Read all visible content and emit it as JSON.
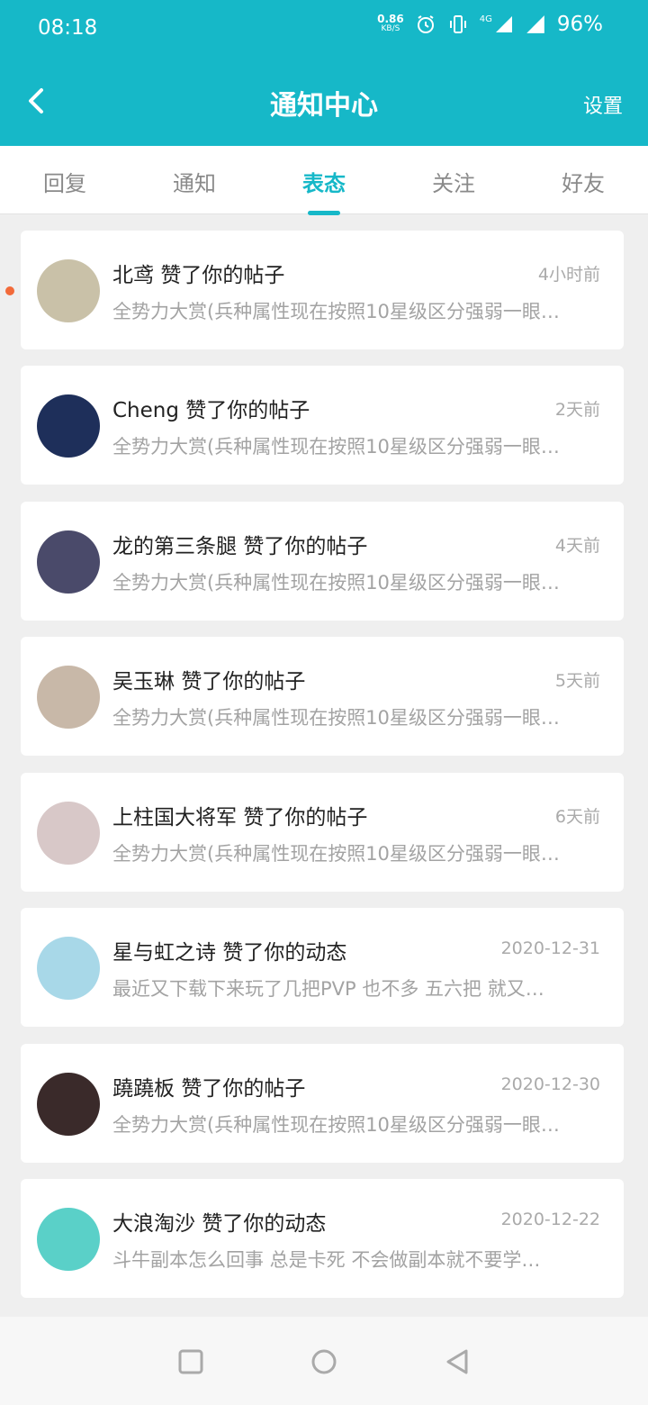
{
  "status_bar": {
    "time": "08:18",
    "net_speed_value": "0.86",
    "net_speed_unit": "KB/S",
    "network_type": "4G",
    "battery": "96%",
    "icons": [
      "alarm-icon",
      "vibrate-icon",
      "signal-icon",
      "battery-icon"
    ]
  },
  "header": {
    "title": "通知中心",
    "settings_label": "设置",
    "back_icon": "chevron-left-icon"
  },
  "tabs": [
    {
      "label": "回复",
      "active": false
    },
    {
      "label": "通知",
      "active": false
    },
    {
      "label": "表态",
      "active": true
    },
    {
      "label": "关注",
      "active": false
    },
    {
      "label": "好友",
      "active": false
    }
  ],
  "notifications": [
    {
      "user": "北鸢",
      "action": "赞了你的帖子",
      "time": "4小时前",
      "excerpt": "全势力大赏(兵种属性现在按照10星级区分强弱一眼…",
      "unread": true,
      "avatar_color": "#c9c1a8"
    },
    {
      "user": "Cheng",
      "action": "赞了你的帖子",
      "time": "2天前",
      "excerpt": "全势力大赏(兵种属性现在按照10星级区分强弱一眼…",
      "unread": false,
      "avatar_color": "#1e2f5a"
    },
    {
      "user": "龙的第三条腿",
      "action": "赞了你的帖子",
      "time": "4天前",
      "excerpt": "全势力大赏(兵种属性现在按照10星级区分强弱一眼…",
      "unread": false,
      "avatar_color": "#4a4a6a"
    },
    {
      "user": "吴玉琳",
      "action": "赞了你的帖子",
      "time": "5天前",
      "excerpt": "全势力大赏(兵种属性现在按照10星级区分强弱一眼…",
      "unread": false,
      "avatar_color": "#c8b8a8"
    },
    {
      "user": "上柱国大将军",
      "action": "赞了你的帖子",
      "time": "6天前",
      "excerpt": "全势力大赏(兵种属性现在按照10星级区分强弱一眼…",
      "unread": false,
      "avatar_color": "#d8c8c8"
    },
    {
      "user": "星与虹之诗",
      "action": "赞了你的动态",
      "time": "2020-12-31",
      "excerpt": "最近又下载下来玩了几把PVP 也不多 五六把 就又…",
      "unread": false,
      "avatar_color": "#a8d8e8"
    },
    {
      "user": "蹺蹺板",
      "action": "赞了你的帖子",
      "time": "2020-12-30",
      "excerpt": "全势力大赏(兵种属性现在按照10星级区分强弱一眼…",
      "unread": false,
      "avatar_color": "#3a2a2a"
    },
    {
      "user": "大浪淘沙",
      "action": "赞了你的动态",
      "time": "2020-12-22",
      "excerpt": "斗牛副本怎么回事 总是卡死 不会做副本就不要学…",
      "unread": false,
      "avatar_color": "#5ad0c8"
    }
  ],
  "nav_bar": {
    "icons": [
      "recents-square-icon",
      "home-circle-icon",
      "back-triangle-icon"
    ]
  }
}
